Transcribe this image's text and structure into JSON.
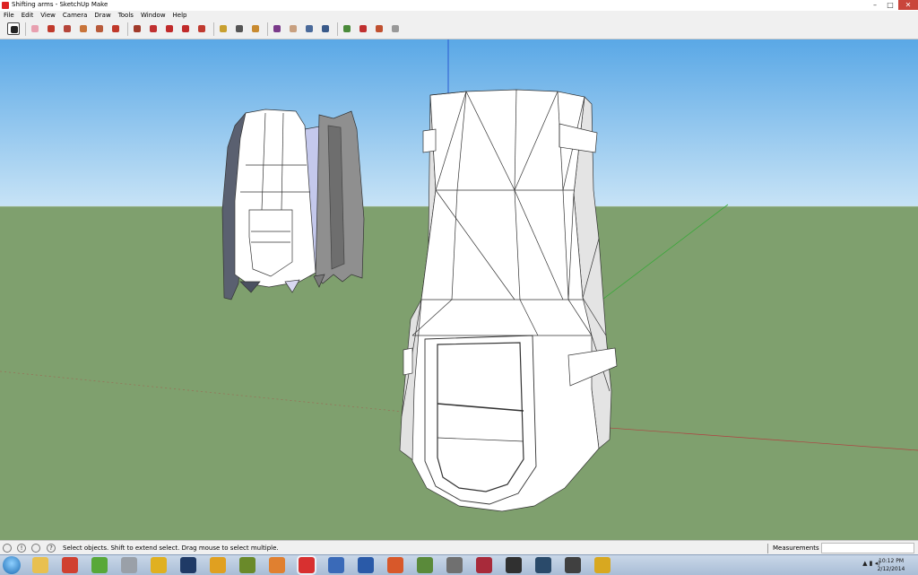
{
  "window": {
    "title": "Shifting arms - SketchUp Make",
    "controls": [
      "–",
      "□",
      "✕"
    ]
  },
  "menu": [
    "File",
    "Edit",
    "View",
    "Camera",
    "Draw",
    "Tools",
    "Window",
    "Help"
  ],
  "toolbar": {
    "tools": [
      {
        "name": "select-tool",
        "icon": "arrow-cursor-icon",
        "color": "#222222",
        "active": true
      },
      {
        "name": "eraser-tool",
        "icon": "eraser-icon",
        "color": "#e8a0b0"
      },
      {
        "name": "line-tool",
        "icon": "pencil-icon",
        "color": "#c0392b"
      },
      {
        "name": "rectangle-tool",
        "icon": "rectangle-icon",
        "color": "#b5453a"
      },
      {
        "name": "circle-tool",
        "icon": "circle-icon",
        "color": "#c8743a"
      },
      {
        "name": "polygon-tool",
        "icon": "polygon-icon",
        "color": "#b85a3a"
      },
      {
        "name": "arc-tool",
        "icon": "arc-icon",
        "color": "#c0392b"
      },
      {
        "name": "push-pull-tool",
        "icon": "push-pull-icon",
        "color": "#a03a2a"
      },
      {
        "name": "follow-me-tool",
        "icon": "follow-me-icon",
        "color": "#c03030"
      },
      {
        "name": "move-tool",
        "icon": "move-arrows-icon",
        "color": "#c02a2a"
      },
      {
        "name": "rotate-tool",
        "icon": "rotate-icon",
        "color": "#c02a2a"
      },
      {
        "name": "scale-tool",
        "icon": "scale-icon",
        "color": "#c03a30"
      },
      {
        "name": "tape-measure-tool",
        "icon": "tape-measure-icon",
        "color": "#c8a030"
      },
      {
        "name": "text-tool",
        "icon": "text-icon",
        "color": "#555555"
      },
      {
        "name": "paint-bucket-tool",
        "icon": "paint-bucket-icon",
        "color": "#c88a30"
      },
      {
        "name": "orbit-tool",
        "icon": "orbit-icon",
        "color": "#7a3a8a"
      },
      {
        "name": "pan-tool",
        "icon": "hand-icon",
        "color": "#c8a080"
      },
      {
        "name": "zoom-tool",
        "icon": "magnifier-icon",
        "color": "#4a6a9a"
      },
      {
        "name": "zoom-extents-tool",
        "icon": "zoom-extents-icon",
        "color": "#3a5a8a"
      },
      {
        "name": "get-models-tool",
        "icon": "warehouse-icon",
        "color": "#4a8a3a"
      },
      {
        "name": "components-tool",
        "icon": "components-icon",
        "color": "#c03030"
      },
      {
        "name": "share-model-tool",
        "icon": "share-model-icon",
        "color": "#c05030"
      },
      {
        "name": "extension-warehouse-tool",
        "icon": "extension-warehouse-icon",
        "color": "#999999"
      }
    ]
  },
  "colors": {
    "sky": "#73b8e8",
    "ground": "#7fa06e",
    "model_face": "#ffffff",
    "model_shadow": "#d8d8d8",
    "axis_red": "#b04040",
    "axis_green": "#3aa83a",
    "axis_blue": "#2a5ad0"
  },
  "statusbar": {
    "icons": [
      "geolocation-icon",
      "credits-icon",
      "user-icon",
      "help-icon"
    ],
    "help_text": "Select objects. Shift to extend select. Drag mouse to select multiple.",
    "measurements_label": "Measurements",
    "measurements_value": ""
  },
  "taskbar": {
    "apps": [
      {
        "name": "explorer-app",
        "icon": "folder-icon",
        "color": "#e8c050"
      },
      {
        "name": "chrome-app",
        "icon": "chrome-icon",
        "color": "#d04030"
      },
      {
        "name": "utorrent-app",
        "icon": "utorrent-icon",
        "color": "#58a838"
      },
      {
        "name": "tube-app",
        "icon": "tube-icon",
        "color": "#9aa0a8"
      },
      {
        "name": "norton-app",
        "icon": "norton-icon",
        "color": "#e0b020"
      },
      {
        "name": "photoshop-app",
        "icon": "photoshop-icon",
        "color": "#1f3a66"
      },
      {
        "name": "headphones-app",
        "icon": "headphones-icon",
        "color": "#e0a020"
      },
      {
        "name": "keyboard-app",
        "icon": "keyboard-icon",
        "color": "#6a8a2a"
      },
      {
        "name": "blender-app",
        "icon": "blender-icon",
        "color": "#e08030"
      },
      {
        "name": "sketchup-app",
        "icon": "sketchup-icon",
        "color": "#d83030",
        "active": true
      },
      {
        "name": "chat-app",
        "icon": "chat-icon",
        "color": "#3a6ab8"
      },
      {
        "name": "word-app",
        "icon": "word-icon",
        "color": "#2a5aa8"
      },
      {
        "name": "powerpoint-app",
        "icon": "powerpoint-icon",
        "color": "#d8582a"
      },
      {
        "name": "minecraft-app",
        "icon": "minecraft-icon",
        "color": "#5a8a3a"
      },
      {
        "name": "skyrim-app",
        "icon": "skyrim-icon",
        "color": "#707070"
      },
      {
        "name": "maroon-app",
        "icon": "game-icon",
        "color": "#a82a3a"
      },
      {
        "name": "forza-app",
        "icon": "forza-icon",
        "color": "#303030"
      },
      {
        "name": "nfs-app",
        "icon": "nfs-icon",
        "color": "#2a4a6a"
      },
      {
        "name": "dark-app",
        "icon": "dark-game-icon",
        "color": "#404040"
      },
      {
        "name": "circle-app",
        "icon": "circle-game-icon",
        "color": "#d8a820"
      }
    ],
    "tray": "▲  ▮ ◂)",
    "clock_time": "10:12 PM",
    "clock_date": "2/12/2014"
  }
}
